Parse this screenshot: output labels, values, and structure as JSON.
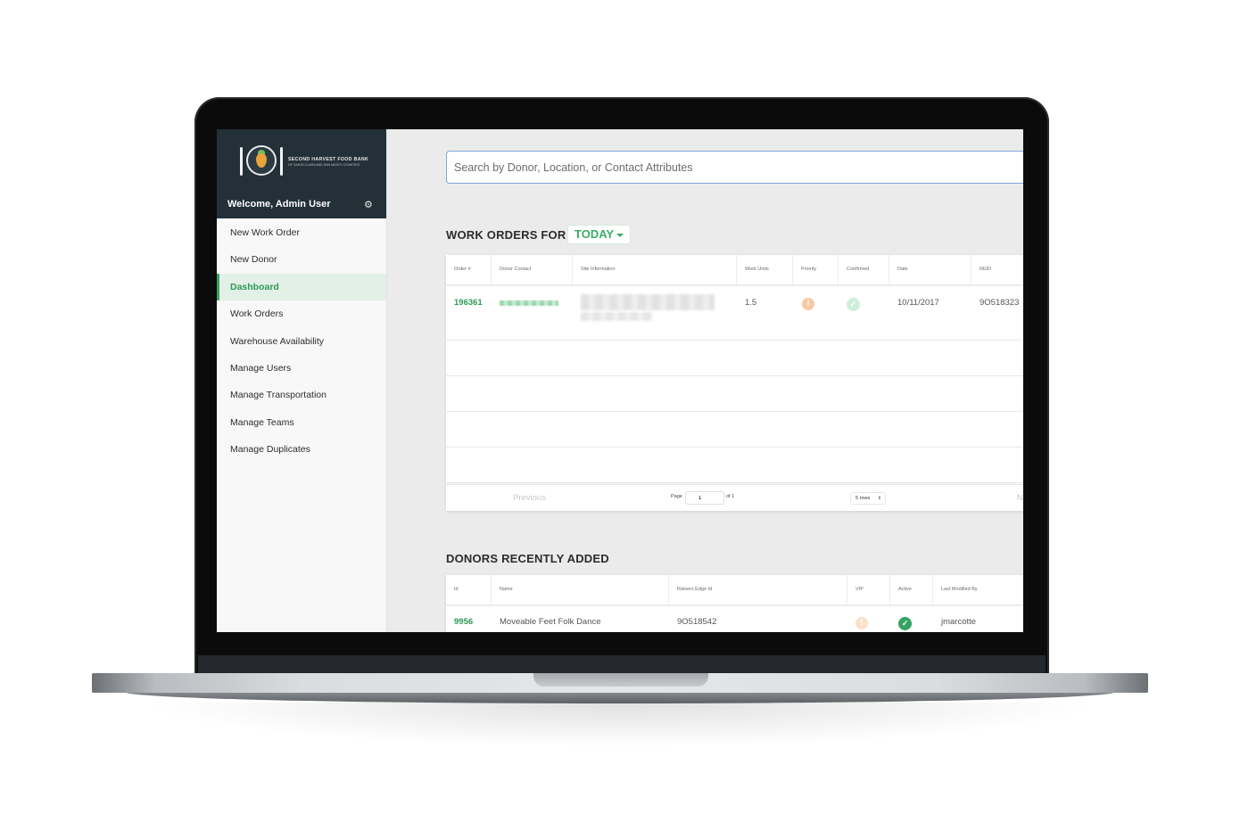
{
  "sidebar": {
    "logo": {
      "title": "Second Harvest Food Bank",
      "subtitle": "of Santa Clara and San Mateo Counties",
      "seal_text": "Second Harvest Food Bank"
    },
    "welcome": "Welcome, Admin User",
    "settings_icon": "gear-icon",
    "items": [
      {
        "label": "New Work Order"
      },
      {
        "label": "New Donor"
      },
      {
        "label": "Dashboard",
        "active": true
      },
      {
        "label": "Work Orders"
      },
      {
        "label": "Warehouse Availability"
      },
      {
        "label": "Manage Users"
      },
      {
        "label": "Manage Transportation"
      },
      {
        "label": "Manage Teams"
      },
      {
        "label": "Manage Duplicates"
      }
    ]
  },
  "search": {
    "placeholder": "Search by Donor, Location, or Contact Attributes"
  },
  "work_orders": {
    "title": "WORK ORDERS FOR",
    "filter_label": "TODAY",
    "columns": [
      "Order #",
      "Donor Contact",
      "Site Information",
      "Work Units",
      "Priority",
      "Confirmed",
      "Date",
      "REID"
    ],
    "rows": [
      {
        "order": "196361",
        "work_units": "1.5",
        "priority_icon": "warning-icon",
        "confirmed_icon": "check-icon",
        "date": "10/11/2017",
        "reid": "9O518323"
      }
    ],
    "pager": {
      "previous": "Previous",
      "page_label": "Page",
      "page_value": "1",
      "of_label": "of 1",
      "rows_label": "5 rows",
      "next": "N"
    }
  },
  "donors": {
    "title": "DONORS RECENTLY ADDED",
    "columns": [
      "Id",
      "Name",
      "Raisers Edge Id",
      "VIP",
      "Active",
      "Last Modified By"
    ],
    "rows": [
      {
        "id": "9956",
        "name": "Moveable Feet Folk Dance",
        "raisers_edge_id": "9O518542",
        "vip_icon": "warning-icon",
        "active_icon": "check-icon",
        "modified_by": "jmarcotte"
      }
    ]
  },
  "colors": {
    "accent_green": "#35a463",
    "sidebar_header": "#233038",
    "search_border": "#7fa9d6"
  }
}
